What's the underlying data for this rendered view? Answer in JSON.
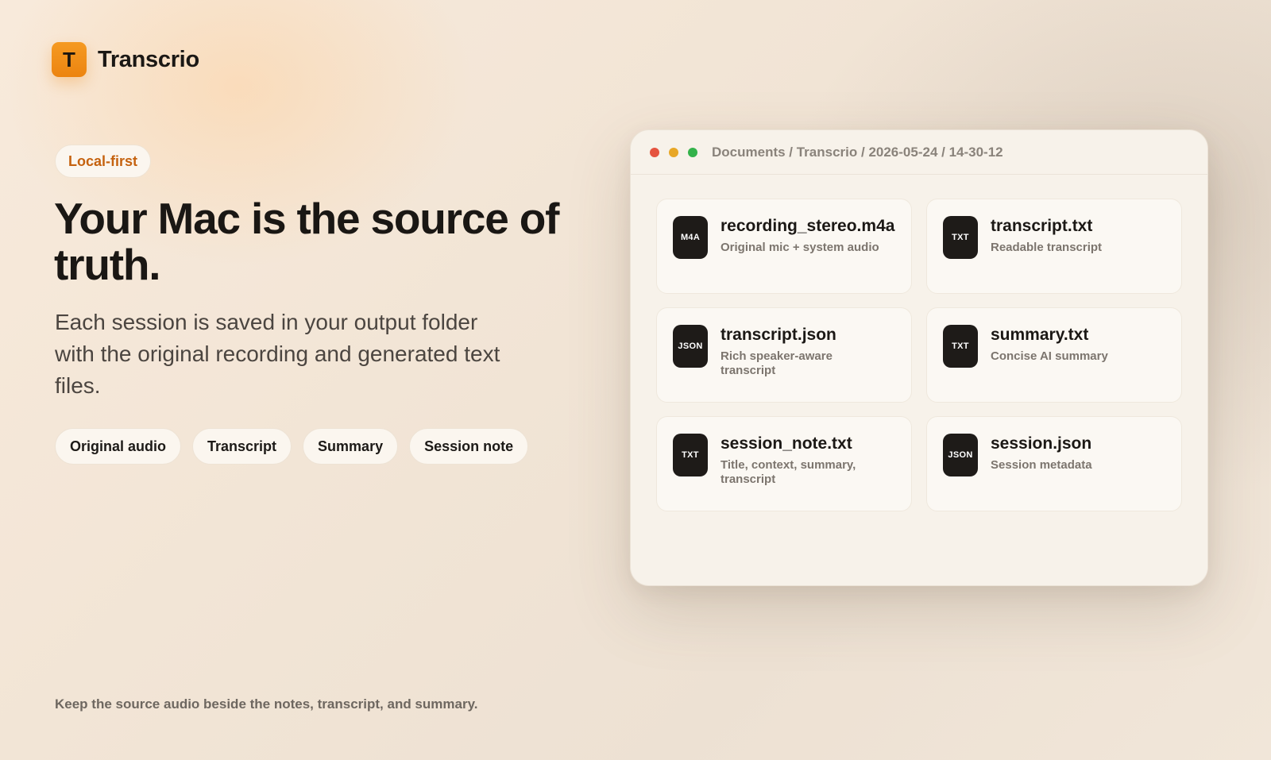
{
  "brand": {
    "logo_letter": "T",
    "name": "Transcrio"
  },
  "hero": {
    "badge": "Local-first",
    "title": "Your Mac is the source of truth.",
    "description": "Each session is saved in your output folder with the original recording and generated text files."
  },
  "chips": [
    "Original audio",
    "Transcript",
    "Summary",
    "Session note"
  ],
  "footer": {
    "note": "Keep the source audio beside the notes, transcript, and summary."
  },
  "window": {
    "path": "Documents / Transcrio / 2026-05-24 / 14-30-12",
    "files": [
      {
        "type": "M4A",
        "name": "recording_stereo.m4a",
        "description": "Original mic + system audio"
      },
      {
        "type": "TXT",
        "name": "transcript.txt",
        "description": "Readable transcript"
      },
      {
        "type": "JSON",
        "name": "transcript.json",
        "description": "Rich speaker-aware transcript"
      },
      {
        "type": "TXT",
        "name": "summary.txt",
        "description": "Concise AI summary"
      },
      {
        "type": "TXT",
        "name": "session_note.txt",
        "description": "Title, context, summary, transcript"
      },
      {
        "type": "JSON",
        "name": "session.json",
        "description": "Session metadata"
      }
    ]
  },
  "colors": {
    "brand_orange": "#ec8410",
    "badge_text": "#c5620f",
    "icon_dark": "#1e1b18",
    "window_close": "#e5533f",
    "window_minimize": "#e8a726",
    "window_zoom": "#33b24a"
  }
}
